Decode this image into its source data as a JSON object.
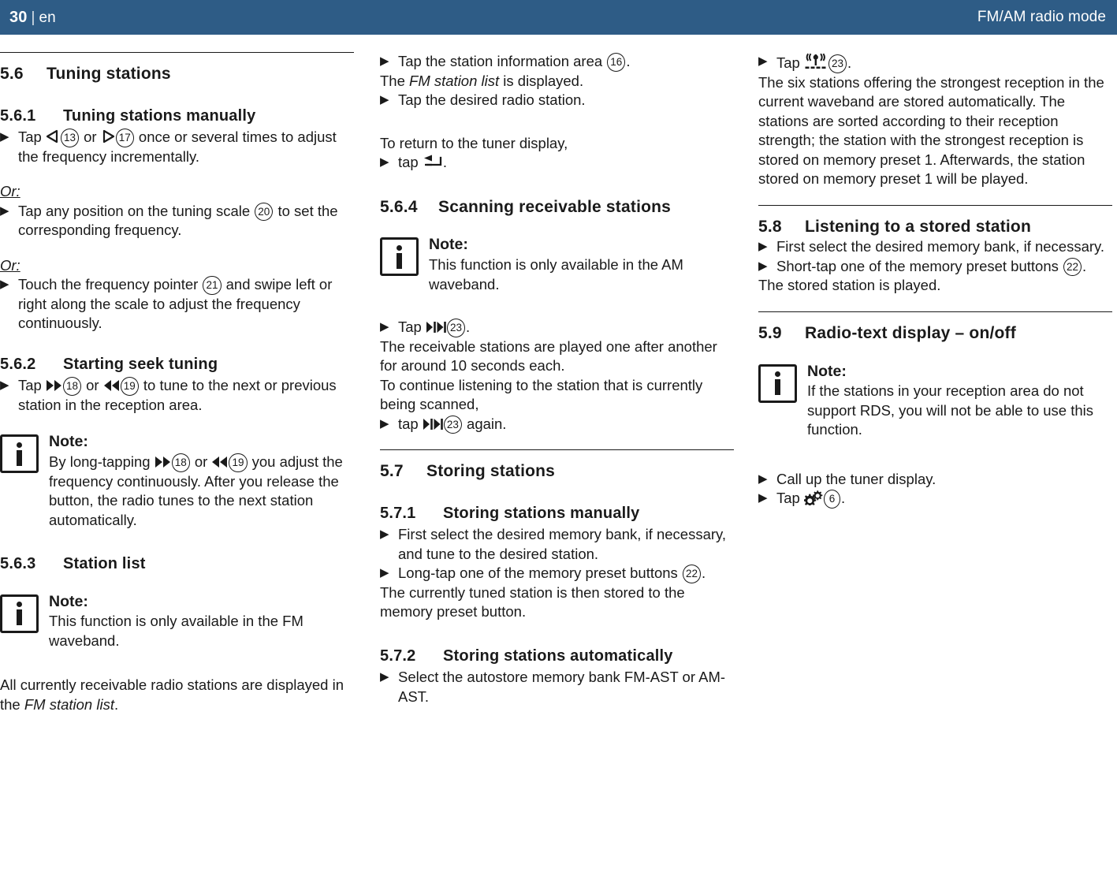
{
  "header": {
    "page_number": "30",
    "separator": "|",
    "language": "en",
    "title": "FM/AM radio mode"
  },
  "column1": {
    "section_5_6": {
      "number": "5.6",
      "title": "Tuning stations"
    },
    "section_5_6_1": {
      "number": "5.6.1",
      "title": "Tuning stations manually"
    },
    "step_tap_prev_next": {
      "pre": "Tap",
      "mid": "or",
      "ref_left": "13",
      "ref_right": "17",
      "post": "once or several times to adjust the frequency incrementally."
    },
    "or_label_1": "Or:",
    "step_tap_scale": {
      "pre": "Tap any position on the tuning scale",
      "ref": "20",
      "post": "to set the corresponding frequency."
    },
    "or_label_2": "Or:",
    "step_touch_pointer": {
      "pre": "Touch the frequency pointer",
      "ref": "21",
      "post": "and swipe left or right along the scale to adjust the frequency continuously."
    },
    "section_5_6_2": {
      "number": "5.6.2",
      "title": "Starting seek tuning"
    },
    "step_seek": {
      "pre": "Tap",
      "mid": "or",
      "ref_ff": "18",
      "ref_rw": "19",
      "post": "to tune to the next or previous station in the reception area."
    },
    "note_longtap": {
      "title": "Note:",
      "pre": "By long-tapping",
      "mid": "or",
      "ref_ff": "18",
      "ref_rw": "19",
      "post": "you adjust the frequency continuously. After you release the button, the radio tunes to the next station automatically."
    },
    "section_5_6_3": {
      "number": "5.6.3",
      "title": "Station list"
    },
    "note_fm_only": {
      "title": "Note:",
      "text": "This function is only available in the FM waveband."
    },
    "paragraph_displayed": {
      "pre": "All currently receivable radio stations are displayed in the ",
      "italic": "FM station list",
      "post": "."
    }
  },
  "column2": {
    "step_tap_info_area": {
      "pre": "Tap the station information area",
      "ref": "16",
      "post": "."
    },
    "line_list_displayed": {
      "pre": "The ",
      "italic": "FM station list",
      "post": " is displayed."
    },
    "step_tap_station": "Tap the desired radio station.",
    "line_return": "To return to the tuner display,",
    "step_tap_back": {
      "pre": "tap",
      "post": "."
    },
    "section_5_6_4": {
      "number": "5.6.4",
      "title": "Scanning receivable stations"
    },
    "note_am_only": {
      "title": "Note:",
      "text": "This function is only available in the AM waveband."
    },
    "step_tap_scan": {
      "pre": "Tap",
      "ref": "23",
      "post": "."
    },
    "line_scan_desc": "The receivable stations are played one after another for around 10 seconds each.",
    "line_continue": "To continue listening to the station that is currently being scanned,",
    "step_tap_scan_again": {
      "pre": "tap",
      "ref": "23",
      "post": "again."
    },
    "section_5_7": {
      "number": "5.7",
      "title": "Storing stations"
    },
    "section_5_7_1": {
      "number": "5.7.1",
      "title": "Storing stations manually"
    },
    "step_select_bank": "First select the desired memory bank, if necessary, and tune to the desired station.",
    "step_longtap_preset": {
      "pre": "Long-tap one of the memory preset buttons",
      "ref": "22",
      "post": "."
    },
    "line_stored": "The currently tuned station is then stored to the memory preset button.",
    "section_5_7_2": {
      "number": "5.7.2",
      "title": "Storing stations automatically"
    },
    "step_select_autostore": "Select the autostore memory bank FM-AST or AM-AST."
  },
  "column3": {
    "step_tap_autostore": {
      "pre": "Tap",
      "ref": "23",
      "post": "."
    },
    "paragraph_six_stations": "The six stations offering the strongest reception in the current waveband are stored automatically. The stations are sorted according to their reception strength; the station with the strongest reception is stored on memory preset 1. Afterwards, the station stored on memory preset 1 will be played.",
    "section_5_8": {
      "number": "5.8",
      "title": "Listening to a stored station"
    },
    "step_select_bank": "First select the desired memory bank, if necessary.",
    "step_shorttap_preset": {
      "pre": "Short-tap one of the memory preset buttons",
      "ref": "22",
      "post": "."
    },
    "line_stored_played": "The stored station is played.",
    "section_5_9": {
      "number": "5.9",
      "title": "Radio-text display – on/off"
    },
    "note_rds": {
      "title": "Note:",
      "text": "If the stations in your reception area do not support RDS, you will not be able to use this function."
    },
    "step_call_tuner": "Call up the tuner display.",
    "step_tap_settings": {
      "pre": "Tap",
      "ref": "6",
      "post": "."
    }
  },
  "icons": {
    "bullet_triangle": "▶",
    "left_triangle": "◁",
    "right_triangle": "▷",
    "fast_forward": "▶▶",
    "rewind": "◀◀",
    "scan": "▶|▶|",
    "back_arrow": "↰",
    "antenna": "antenna-icon",
    "gears": "gears-icon"
  },
  "colors": {
    "header_background": "#2e5c86",
    "header_text": "#ffffff",
    "body_text": "#1a1a1a",
    "rule": "#1a1a1a"
  }
}
